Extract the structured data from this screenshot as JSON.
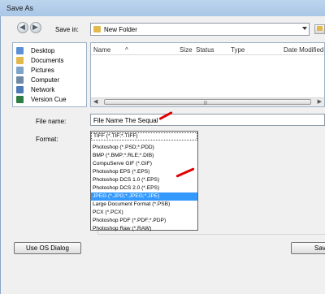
{
  "window": {
    "title": "Save As"
  },
  "toolbar": {
    "back_icon": "back-arrow-icon",
    "forward_icon": "forward-arrow-icon",
    "save_in_label": "Save in:",
    "save_in_value": "New Folder",
    "new_folder_icon": "new-folder-icon"
  },
  "places": [
    {
      "label": "Desktop",
      "icon": "desktop-icon",
      "color": "#5b8fd6"
    },
    {
      "label": "Documents",
      "icon": "documents-icon",
      "color": "#e3b94b"
    },
    {
      "label": "Pictures",
      "icon": "pictures-icon",
      "color": "#7fa4c9"
    },
    {
      "label": "Computer",
      "icon": "computer-icon",
      "color": "#6f8aa6"
    },
    {
      "label": "Network",
      "icon": "network-icon",
      "color": "#4e79b8"
    },
    {
      "label": "Version Cue",
      "icon": "version-cue-icon",
      "color": "#2e7d43"
    }
  ],
  "file_list": {
    "columns": [
      "Name",
      "Size",
      "Status",
      "Type",
      "Date Modified"
    ],
    "sort_indicator": "^"
  },
  "form": {
    "file_name_label": "File name:",
    "file_name_value": "File Name The Sequal",
    "format_label": "Format:",
    "format_options": [
      "TIFF (*.TIF;*.TIFF)",
      "Photoshop (*.PSD;*.PDD)",
      "BMP (*.BMP;*.RLE;*.DIB)",
      "CompuServe GIF (*.GIF)",
      "Photoshop EPS (*.EPS)",
      "Photoshop DCS 1.0 (*.EPS)",
      "Photoshop DCS 2.0 (*.EPS)",
      "JPEG (*.JPG;*.JPEG;*.JPE)",
      "Large Document Format (*.PSB)",
      "PCX (*.PCX)",
      "Photoshop PDF (*.PDF;*.PDP)",
      "Photoshop Raw (*.RAW)"
    ],
    "selected_format": "JPEG (*.JPG;*.JPEG;*.JPE)"
  },
  "buttons": {
    "use_os_dialog": "Use OS Dialog",
    "save": "Save"
  },
  "colors": {
    "selection": "#3399ff",
    "annotation": "#e00000"
  }
}
